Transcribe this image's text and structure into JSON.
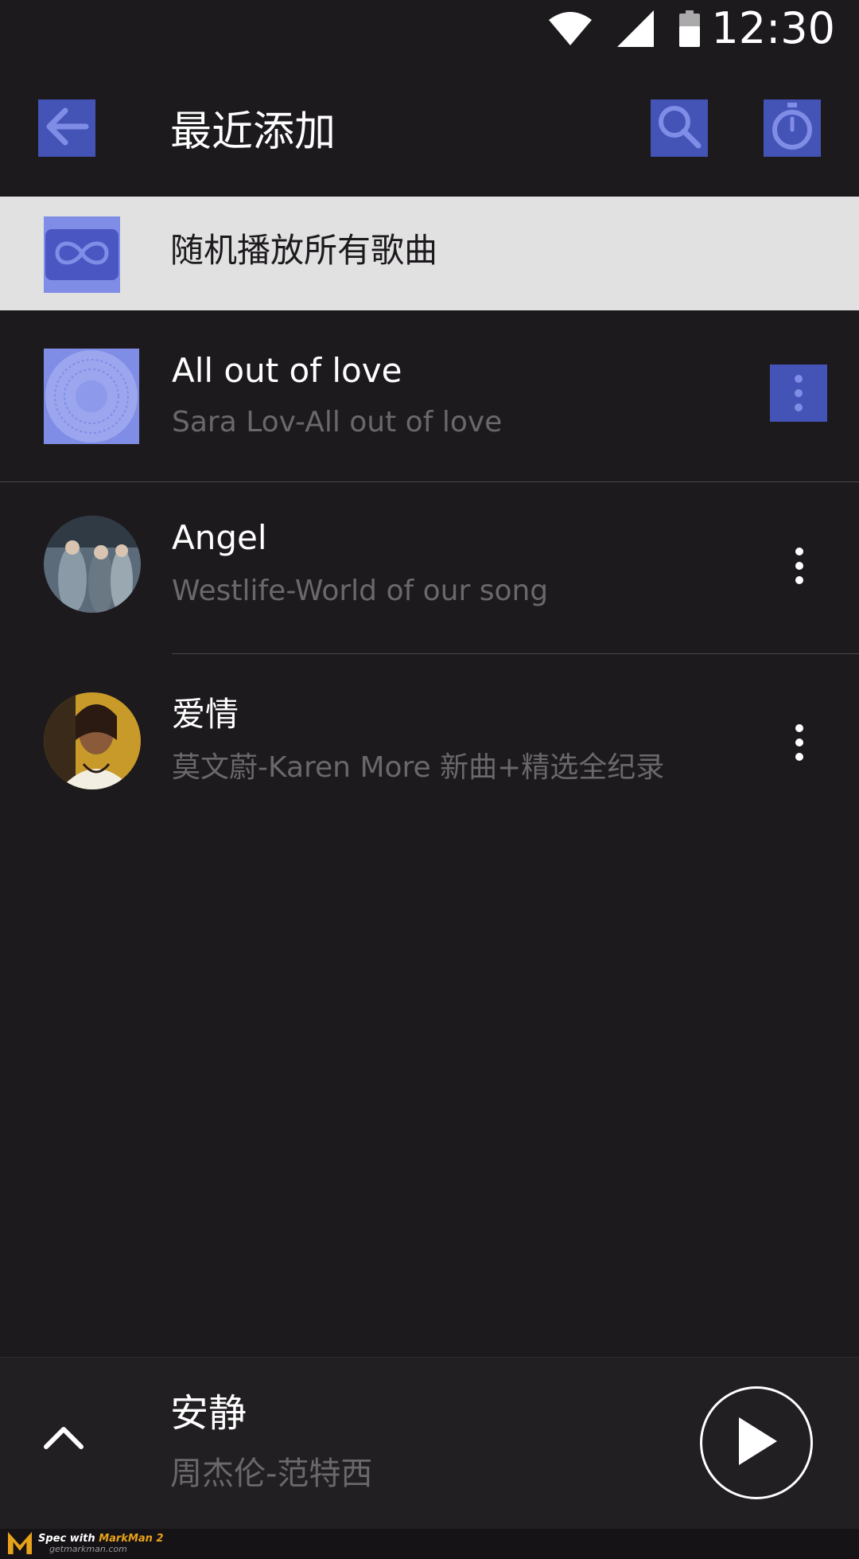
{
  "status_bar": {
    "time": "12:30"
  },
  "toolbar": {
    "title": "最近添加",
    "back_icon": "arrow-left-icon",
    "search_icon": "search-icon",
    "timer_icon": "stopwatch-icon"
  },
  "shuffle": {
    "label": "随机播放所有歌曲",
    "icon": "infinity-icon"
  },
  "songs": [
    {
      "title": "All out of love",
      "subtitle": "Sara Lov-All out of love"
    },
    {
      "title": "Angel",
      "subtitle": "Westlife-World of our song"
    },
    {
      "title": "爱情",
      "subtitle": "莫文蔚-Karen More 新曲+精选全纪录"
    }
  ],
  "now_playing": {
    "title": "安静",
    "subtitle": "周杰伦-范特西"
  },
  "footer": {
    "brand_prefix": "Spec with ",
    "brand_name": "MarkMan 2",
    "brand_url": "getmarkman.com"
  },
  "colors": {
    "background": "#1d1a1d",
    "highlight_row": "#e2e1e2",
    "accent": "#4453b6",
    "subtitle": "#6b686b"
  }
}
